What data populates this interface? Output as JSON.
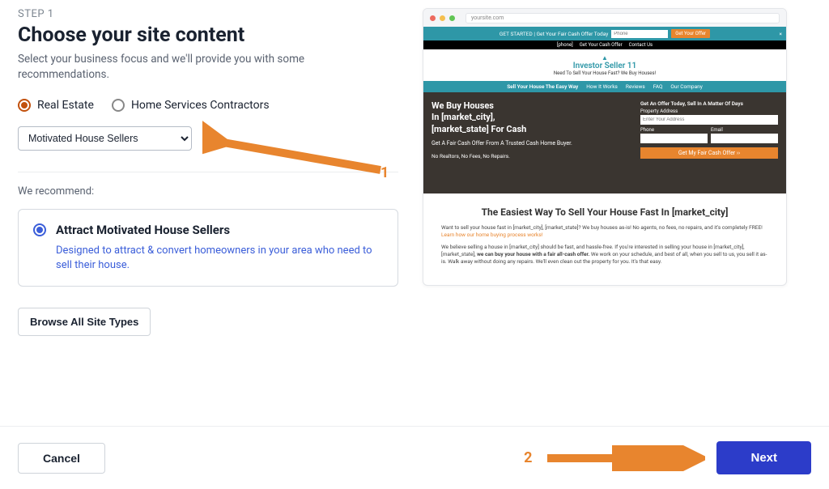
{
  "step_label": "STEP 1",
  "title": "Choose your site content",
  "subtitle": "Select your business focus and we'll provide you with some recommendations.",
  "radios": {
    "real_estate": "Real Estate",
    "contractors": "Home Services Contractors"
  },
  "dropdown": {
    "selected": "Motivated House Sellers"
  },
  "recommend_label": "We recommend:",
  "rec_card": {
    "title": "Attract Motivated House Sellers",
    "desc": "Designed to attract & convert homeowners in your area who need to sell their house."
  },
  "browse_btn": "Browse All Site Types",
  "cancel": "Cancel",
  "next": "Next",
  "annotations": {
    "one": "1",
    "two": "2"
  },
  "preview": {
    "url": "yoursite.com",
    "offer_bar": {
      "text": "GET STARTED | Get Your Fair Cash Offer Today",
      "placeholder": "Phone",
      "btn": "Get Your Offer"
    },
    "black_bar": {
      "phone": "[phone]",
      "links": [
        "Get Your Cash Offer",
        "Contact Us"
      ]
    },
    "logo": {
      "name": "Investor Seller 11",
      "tag": "Need To Sell Your House Fast? We Buy Houses!"
    },
    "nav": [
      "Sell Your House The Easy Way",
      "How It Works",
      "Reviews",
      "FAQ",
      "Our Company"
    ],
    "hero": {
      "headline1": "We Buy Houses",
      "headline2": "In [market_city],",
      "headline3": "[market_state] For Cash",
      "sub": "Get A Fair Cash Offer From A Trusted Cash Home Buyer.",
      "norepairs": "No Realtors, No Fees, No Repairs.",
      "form_title": "Get An Offer Today, Sell In A Matter Of Days",
      "addr_label": "Property Address",
      "addr_placeholder": "Enter Your Address",
      "phone_label": "Phone",
      "email_label": "Email",
      "cta": "Get My Fair Cash Offer ››"
    },
    "content": {
      "h3": "The Easiest Way To Sell Your House Fast In [market_city]",
      "p1a": "Want to sell your house fast in [market_city], [market_state]? We buy houses as-is! No agents, no fees, no repairs, and it's completely FREE! ",
      "p1link": "Learn how our home buying process works!",
      "p2a": "We believe selling a house in [market_city] should be fast, and hassle-free. If you're interested in selling your house in [market_city], [market_state], ",
      "p2b": "we can buy your house with a fair all-cash offer.",
      "p2c": " We work on your schedule, and best of all, when you sell to us, you sell it as-is. Walk away without doing any repairs. We'll even clean out the property for you. It's that easy."
    }
  }
}
